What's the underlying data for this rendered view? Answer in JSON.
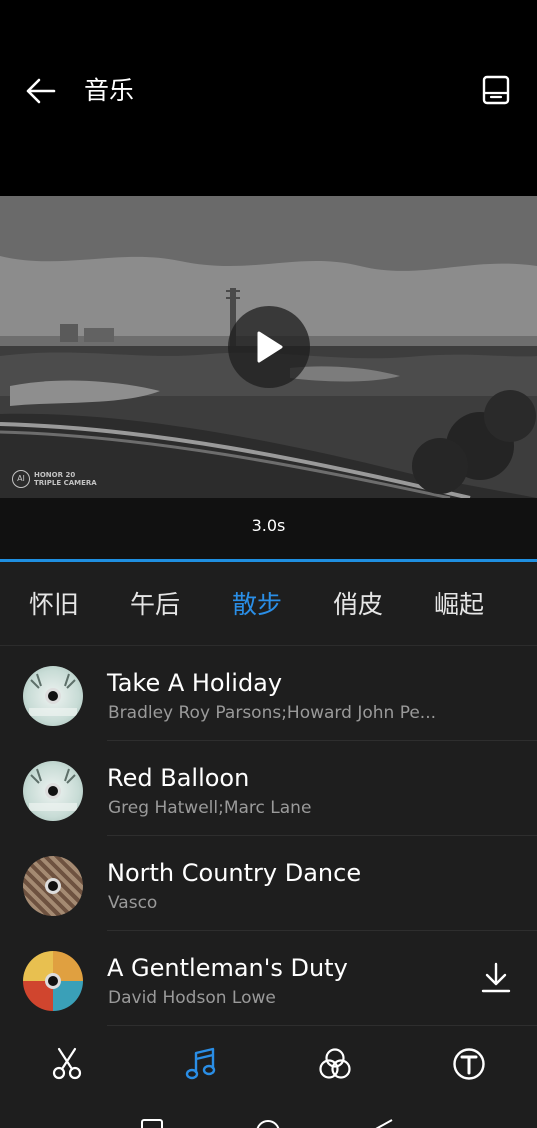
{
  "header": {
    "title": "音乐",
    "back_icon": "back-arrow-icon",
    "save_icon": "save-icon"
  },
  "preview": {
    "watermark_line1": "HONOR 20",
    "watermark_line2": "TRIPLE CAMERA",
    "duration": "3.0s"
  },
  "tabs": [
    {
      "label": "怀旧",
      "active": false
    },
    {
      "label": "午后",
      "active": false
    },
    {
      "label": "散步",
      "active": true
    },
    {
      "label": "俏皮",
      "active": false
    },
    {
      "label": "崛起",
      "active": false
    }
  ],
  "songs": [
    {
      "title": "Take A Holiday",
      "artist": "Bradley Roy Parsons;Howard John Pe...",
      "cover_color": "#c9dcd6",
      "downloadable": false
    },
    {
      "title": "Red Balloon",
      "artist": "Greg  Hatwell;Marc  Lane",
      "cover_color": "#c9dcd6",
      "downloadable": false
    },
    {
      "title": "North Country Dance",
      "artist": "Vasco",
      "cover_color": "#8a6a52",
      "downloadable": false
    },
    {
      "title": "A Gentleman's Duty",
      "artist": "David Hodson Lowe",
      "cover_color": "#d98f3a",
      "downloadable": true
    }
  ],
  "toolbar": {
    "items": [
      "scissors-icon",
      "music-note-icon",
      "filter-circles-icon",
      "text-icon"
    ],
    "active_index": 1
  },
  "colors": {
    "accent": "#2a8ee6",
    "panel_bg": "#1e1e1e",
    "header_bg": "#000000"
  }
}
